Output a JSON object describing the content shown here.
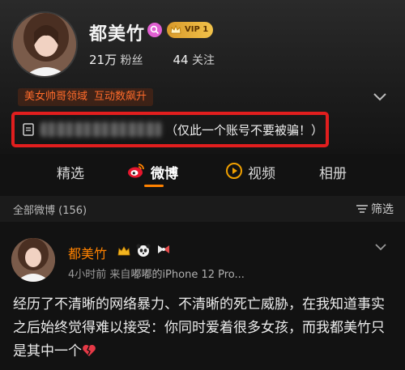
{
  "profile": {
    "name": "都美竹",
    "vip_label": "VIP 1",
    "followers_count": "21万",
    "followers_label": "粉丝",
    "following_count": "44",
    "following_label": "关注",
    "field_tag": "美女帅哥领域",
    "interaction_tag": "互动数飙升",
    "note_visible_text": "（仅此一个账号不要被骗！）"
  },
  "tabs": [
    {
      "label": "精选"
    },
    {
      "label": "微博",
      "active": true
    },
    {
      "label": "视频"
    },
    {
      "label": "相册"
    }
  ],
  "filter_bar": {
    "all_posts_label": "全部微博 (156)",
    "filter_label": "筛选"
  },
  "post": {
    "author": "都美竹",
    "time": "4小时前",
    "source_prefix": "来自",
    "source_device": "嘟嘟的iPhone 12 Pro...",
    "body": "经历了不清晰的网络暴力、不清晰的死亡威胁，在我知道事实之后始终觉得难以接受：你同时爱着很多女孩，而我都美竹只是其中一个"
  },
  "colors": {
    "accent_orange": "#ff8200",
    "highlight_red": "#e11e1e",
    "vip_gold": "#f1c24a"
  },
  "icons": [
    "search-badge-icon",
    "vip-crown-icon",
    "chevron-down-icon",
    "note-icon",
    "weibo-icon",
    "video-icon",
    "filter-icon",
    "crown-badge-icon",
    "panda-icon",
    "bow-icon",
    "caret-down-icon",
    "broken-heart-icon"
  ]
}
